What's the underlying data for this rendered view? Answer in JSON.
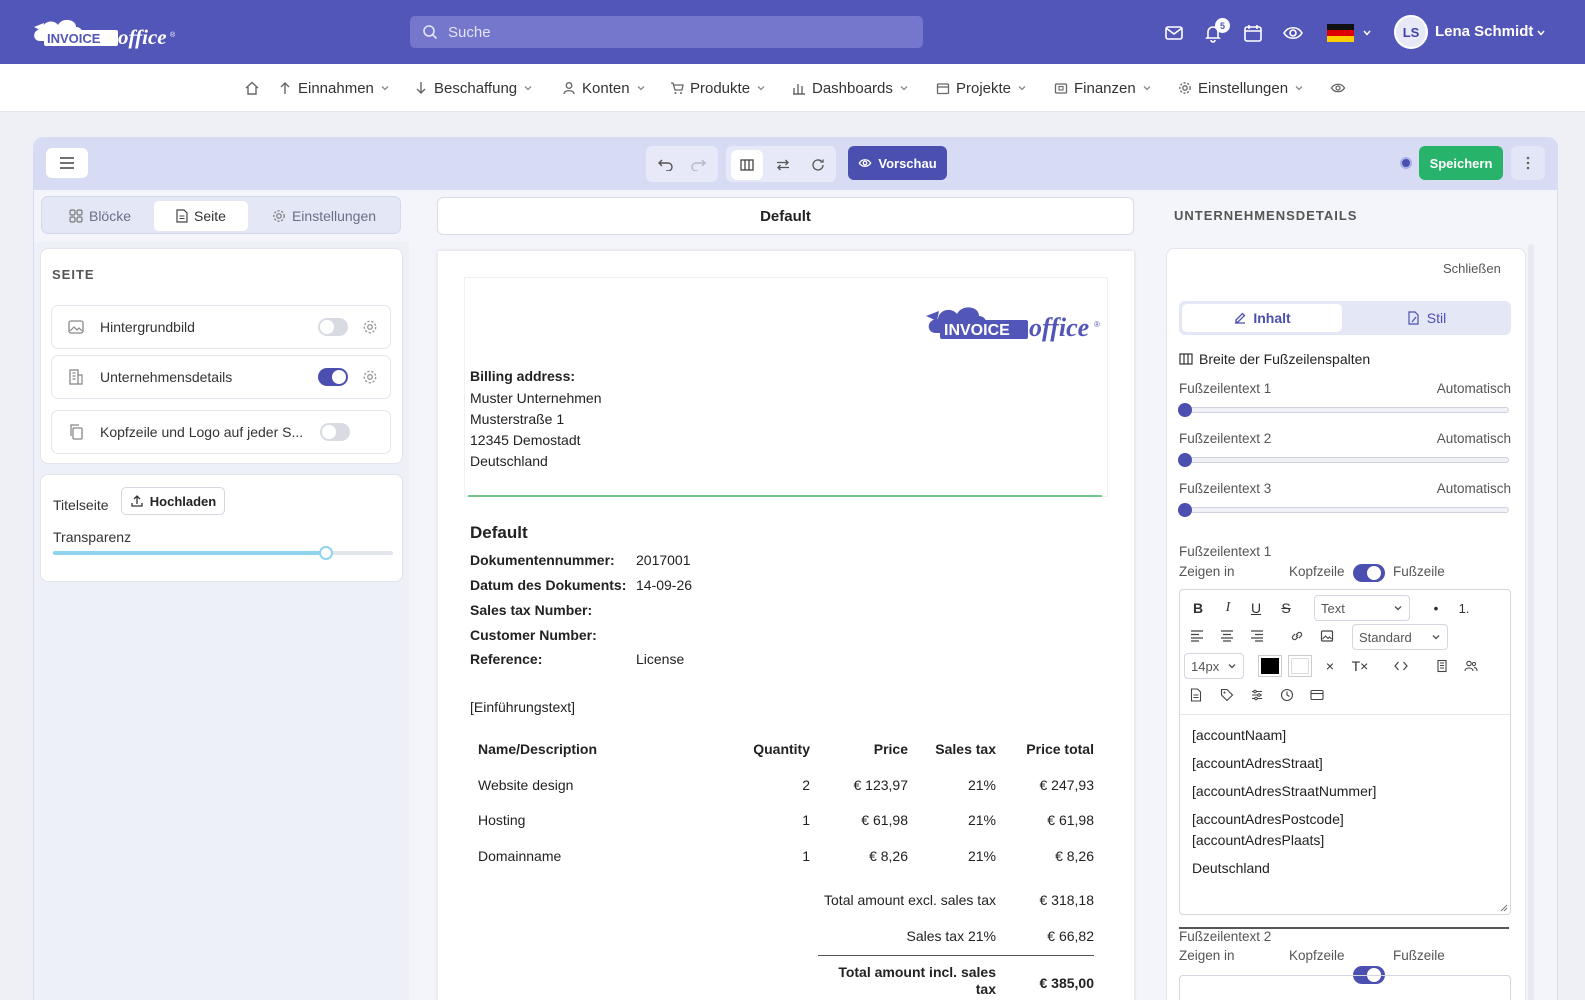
{
  "app": {
    "search_placeholder": "Suche",
    "notification_count": "5",
    "user_initials": "LS",
    "user_name": "Lena Schmidt"
  },
  "nav": {
    "items": [
      {
        "label": "Einnahmen",
        "icon": "arrow-up-icon"
      },
      {
        "label": "Beschaffung",
        "icon": "arrow-down-icon"
      },
      {
        "label": "Konten",
        "icon": "person-icon"
      },
      {
        "label": "Produkte",
        "icon": "cart-icon"
      },
      {
        "label": "Dashboards",
        "icon": "bar-chart-icon"
      },
      {
        "label": "Projekte",
        "icon": "calendar-icon"
      },
      {
        "label": "Finanzen",
        "icon": "wallet-icon"
      },
      {
        "label": "Einstellungen",
        "icon": "gear-icon"
      }
    ]
  },
  "toolbar": {
    "preview_label": "Vorschau",
    "save_label": "Speichern"
  },
  "left": {
    "tabs": [
      "Blöcke",
      "Seite",
      "Einstellungen"
    ],
    "active_tab": 1,
    "section_title": "SEITE",
    "options": [
      {
        "label": "Hintergrundbild",
        "on": false
      },
      {
        "label": "Unternehmensdetails",
        "on": true
      },
      {
        "label": "Kopfzeile und Logo auf jeder S...",
        "on": false
      }
    ],
    "title_page_label": "Titelseite",
    "upload_label": "Hochladen",
    "transparency_label": "Transparenz",
    "transparency_value": 0.8
  },
  "doc": {
    "name": "Default",
    "billing_title": "Billing address:",
    "billing_lines": [
      "Muster Unternehmen",
      "Musterstraße 1",
      "12345 Demostadt",
      "Deutschland"
    ],
    "heading": "Default",
    "meta": [
      {
        "label": "Dokumentennummer:",
        "value": "2017001"
      },
      {
        "label": "Datum des Dokuments:",
        "value": "14-09-26"
      },
      {
        "label": "Sales tax Number:",
        "value": ""
      },
      {
        "label": "Customer Number:",
        "value": ""
      },
      {
        "label": "Reference:",
        "value": "License"
      }
    ],
    "intro": "[Einführungstext]",
    "columns": [
      "Name/Description",
      "Quantity",
      "Price",
      "Sales tax",
      "Price total"
    ],
    "rows": [
      [
        "Website design",
        "2",
        "€ 123,97",
        "21%",
        "€ 247,93"
      ],
      [
        "Hosting",
        "1",
        "€ 61,98",
        "21%",
        "€ 61,98"
      ],
      [
        "Domainname",
        "1",
        "€ 8,26",
        "21%",
        "€ 8,26"
      ]
    ],
    "totals": [
      {
        "label": "Total amount excl. sales tax",
        "value": "€ 318,18"
      },
      {
        "label": "Sales tax 21%",
        "value": "€ 66,82"
      }
    ],
    "grand_total_label": "Total amount incl. sales tax",
    "grand_total_value": "€ 385,00"
  },
  "right": {
    "title": "UNTERNEHMENSDETAILS",
    "close_label": "Schließen",
    "tab_content": "Inhalt",
    "tab_style": "Stil",
    "widths_label": "Breite der Fußzeilenspalten",
    "footer_cols": [
      {
        "label": "Fußzeilentext 1",
        "value": "Automatisch"
      },
      {
        "label": "Fußzeilentext 2",
        "value": "Automatisch"
      },
      {
        "label": "Fußzeilentext 3",
        "value": "Automatisch"
      }
    ],
    "footer1_title": "Fußzeilentext 1",
    "show_in": "Zeigen in",
    "header_label": "Kopfzeile",
    "footer_label": "Fußzeile",
    "format_select": "Text",
    "font_select": "Standard",
    "size_select": "14px",
    "body_lines": [
      "[accountNaam]",
      "[accountAdresStraat]",
      "[accountAdresStraatNummer]",
      "[accountAdresPostcode]",
      "[accountAdresPlaats]",
      "Deutschland"
    ],
    "footer2_title": "Fußzeilentext 2"
  }
}
